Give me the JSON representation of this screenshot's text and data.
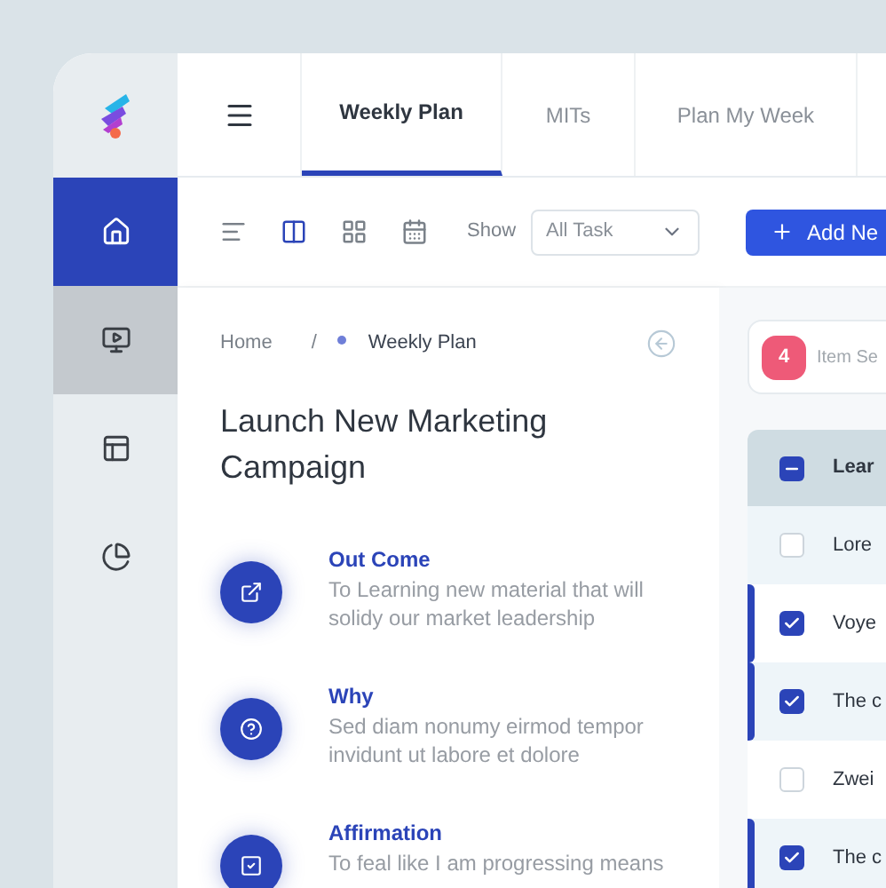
{
  "sidebar": {
    "items": [
      {
        "selected": true,
        "highlighted": false
      },
      {
        "selected": false,
        "highlighted": true
      },
      {
        "selected": false,
        "highlighted": false
      },
      {
        "selected": false,
        "highlighted": false
      }
    ]
  },
  "tabs": [
    {
      "label": "Weekly Plan",
      "selected": true
    },
    {
      "label": "MITs",
      "selected": false
    },
    {
      "label": "Plan My Week",
      "selected": false
    }
  ],
  "toolbar": {
    "views": [
      {
        "selected": false
      },
      {
        "selected": true
      },
      {
        "selected": false
      },
      {
        "selected": false
      }
    ],
    "show_label": "Show",
    "filter": {
      "value": "All Task"
    },
    "add_button": "Add Ne"
  },
  "breadcrumb": [
    {
      "label": "Home"
    },
    {
      "label": "Weekly Plan"
    }
  ],
  "breadcrumb_separator": "/",
  "title": "Launch New Marketing Campaign",
  "sections": [
    {
      "heading": "Out Come",
      "text": "To Learning new material that will solidy our market leadership"
    },
    {
      "heading": "Why",
      "text": "Sed diam nonumy eirmod tempor invidunt ut labore et dolore"
    },
    {
      "heading": "Affirmation",
      "text": "To feal like I am progressing means"
    }
  ],
  "selection": {
    "count": "4",
    "placeholder": "Item Se"
  },
  "table": {
    "header": {
      "label": "Lear",
      "indeterminate": true
    },
    "rows": [
      {
        "text": "Lore",
        "checked": false
      },
      {
        "text": "Voye",
        "checked": true
      },
      {
        "text": "The c",
        "checked": true
      },
      {
        "text": "Zwei",
        "checked": false
      },
      {
        "text": "The c",
        "checked": true
      }
    ]
  }
}
